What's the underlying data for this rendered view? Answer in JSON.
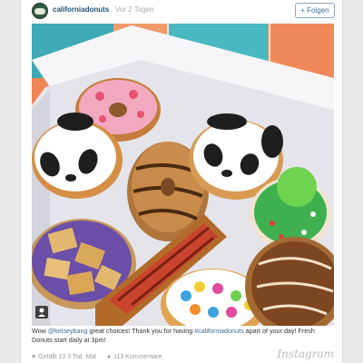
{
  "post": {
    "username": "californiadonuts",
    "time_ago": "Vor 2 Tagen",
    "follow_label": "Folgen"
  },
  "caption": {
    "part1": "Wow ",
    "mention": "@kelseybang",
    "part2": " great choices! Thank you for having ",
    "hashtag": "#californiadonuts",
    "part3": " apart of your day! Fresh Donuts start daily at 3pm!"
  },
  "footer": {
    "likes": "Gefällt 10.3 Tsd. Mal",
    "comments": "113 Kommentare",
    "brand": "Instagram"
  },
  "icons": [
    "heart-icon",
    "comment-icon",
    "plus-icon",
    "user-tag-icon"
  ]
}
